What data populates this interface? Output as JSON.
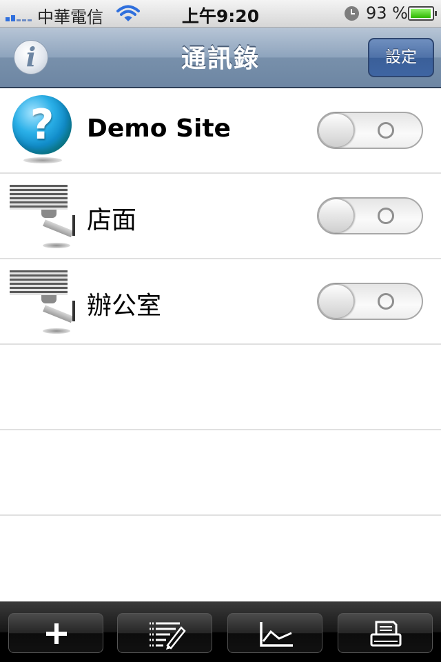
{
  "status_bar": {
    "carrier": "中華電信",
    "time": "上午9:20",
    "battery_percent": "93 %",
    "battery_level": 0.93,
    "signal_icon": "signal-bars-icon",
    "wifi_icon": "wifi-icon",
    "alarm_icon": "alarm-clock-icon"
  },
  "nav_bar": {
    "title": "通訊錄",
    "info_icon": "info-icon",
    "info_glyph": "i",
    "settings_label": "設定"
  },
  "sites": [
    {
      "name": "Demo Site",
      "icon": "help-globe-icon",
      "enabled": false
    },
    {
      "name": "店面",
      "icon": "security-camera-icon",
      "enabled": false
    },
    {
      "name": "辦公室",
      "icon": "security-camera-icon",
      "enabled": false
    }
  ],
  "toolbar": {
    "buttons": [
      {
        "icon": "add-icon"
      },
      {
        "icon": "edit-list-icon"
      },
      {
        "icon": "chart-icon"
      },
      {
        "icon": "print-icon"
      }
    ]
  },
  "colors": {
    "nav_bar": "#7890ab",
    "settings_button": "#4f72a8",
    "toolbar": "#000000",
    "battery_fill": "#2fb800",
    "signal": "#2f6fdd"
  }
}
